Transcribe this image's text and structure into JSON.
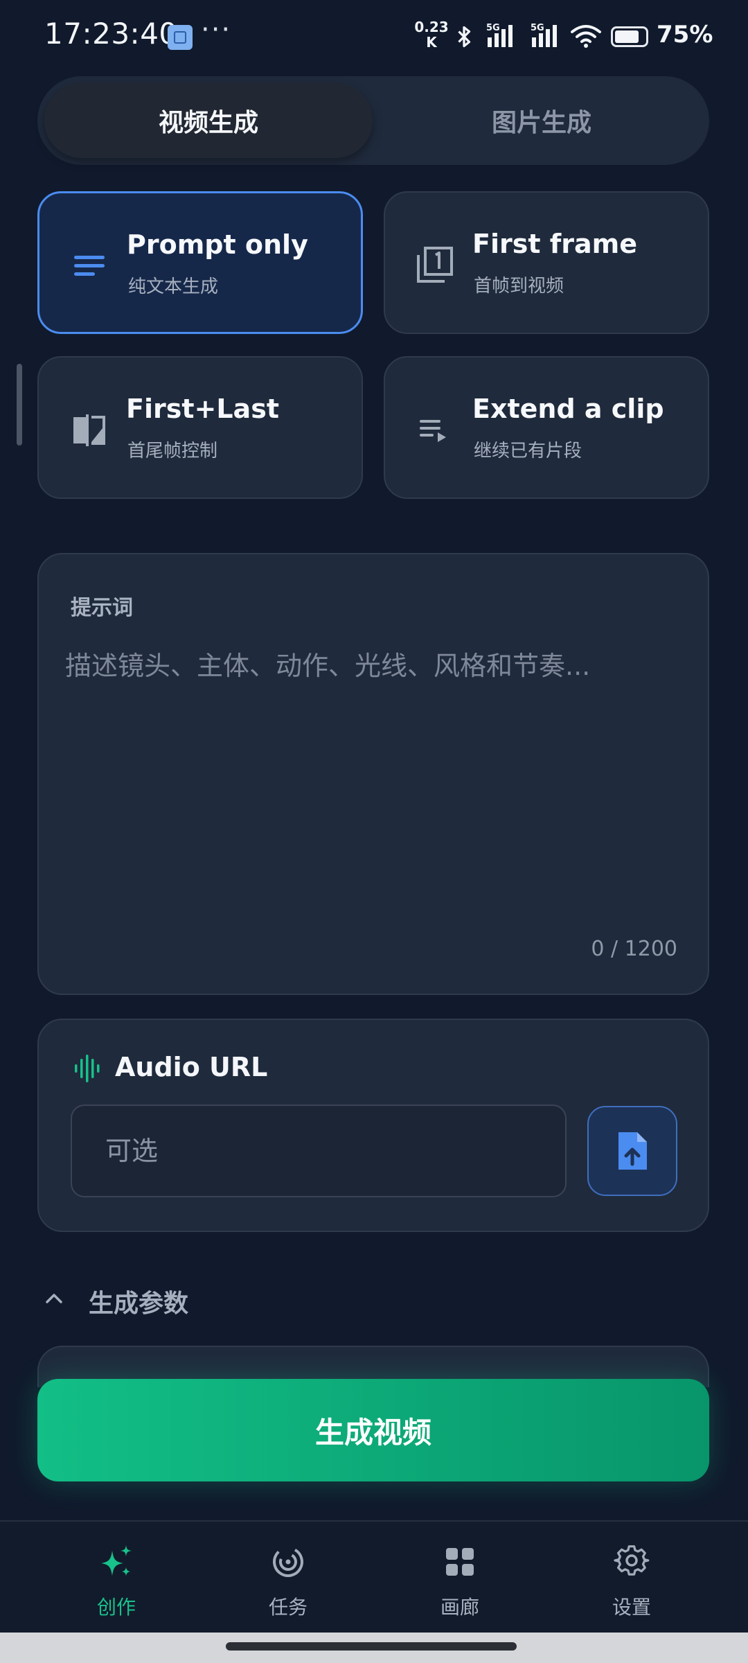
{
  "status_bar": {
    "time": "17:23:40",
    "more": "···",
    "net_speed_value": "0.23",
    "net_speed_unit": "K",
    "sig1_label": "5G",
    "sig2_label": "5G",
    "battery": "75%"
  },
  "tabs": {
    "video": "视频生成",
    "image": "图片生成"
  },
  "modes": [
    {
      "title": "Prompt only",
      "subtitle": "纯文本生成",
      "icon": "text-lines-icon"
    },
    {
      "title": "First frame",
      "subtitle": "首帧到视频",
      "icon": "filter-1-icon"
    },
    {
      "title": "First+Last",
      "subtitle": "首尾帧控制",
      "icon": "compare-icon"
    },
    {
      "title": "Extend a clip",
      "subtitle": "继续已有片段",
      "icon": "playlist-play-icon"
    }
  ],
  "prompt": {
    "label": "提示词",
    "placeholder": "描述镜头、主体、动作、光线、风格和节奏...",
    "count": "0 / 1200"
  },
  "audio": {
    "title": "Audio URL",
    "placeholder": "可选"
  },
  "params": {
    "label": "生成参数"
  },
  "generate_label": "生成视频",
  "nav": {
    "create": "创作",
    "tasks": "任务",
    "gallery": "画廊",
    "settings": "设置"
  },
  "colors": {
    "accent_blue": "#4b8cf0",
    "accent_green": "#12bf86",
    "background": "#101a2c"
  }
}
